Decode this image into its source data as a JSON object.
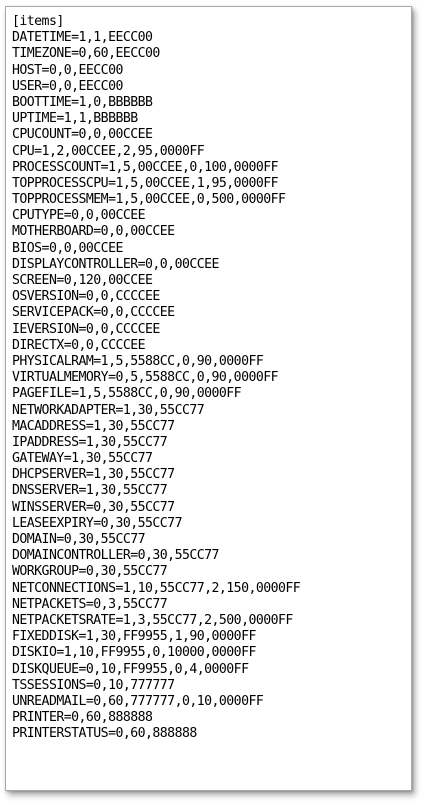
{
  "document": {
    "lines": [
      "[items]",
      "DATETIME=1,1,EECC00",
      "TIMEZONE=0,60,EECC00",
      "HOST=0,0,EECC00",
      "USER=0,0,EECC00",
      "BOOTTIME=1,0,BBBBBB",
      "UPTIME=1,1,BBBBBB",
      "CPUCOUNT=0,0,00CCEE",
      "CPU=1,2,00CCEE,2,95,0000FF",
      "PROCESSCOUNT=1,5,00CCEE,0,100,0000FF",
      "TOPPROCESSCPU=1,5,00CCEE,1,95,0000FF",
      "TOPPROCESSMEM=1,5,00CCEE,0,500,0000FF",
      "CPUTYPE=0,0,00CCEE",
      "MOTHERBOARD=0,0,00CCEE",
      "BIOS=0,0,00CCEE",
      "DISPLAYCONTROLLER=0,0,00CCEE",
      "SCREEN=0,120,00CCEE",
      "OSVERSION=0,0,CCCCEE",
      "SERVICEPACK=0,0,CCCCEE",
      "IEVERSION=0,0,CCCCEE",
      "DIRECTX=0,0,CCCCEE",
      "PHYSICALRAM=1,5,5588CC,0,90,0000FF",
      "VIRTUALMEMORY=0,5,5588CC,0,90,0000FF",
      "PAGEFILE=1,5,5588CC,0,90,0000FF",
      "NETWORKADAPTER=1,30,55CC77",
      "MACADDRESS=1,30,55CC77",
      "IPADDRESS=1,30,55CC77",
      "GATEWAY=1,30,55CC77",
      "DHCPSERVER=1,30,55CC77",
      "DNSSERVER=1,30,55CC77",
      "WINSSERVER=0,30,55CC77",
      "LEASEEXPIRY=0,30,55CC77",
      "DOMAIN=0,30,55CC77",
      "DOMAINCONTROLLER=0,30,55CC77",
      "WORKGROUP=0,30,55CC77",
      "NETCONNECTIONS=1,10,55CC77,2,150,0000FF",
      "NETPACKETS=0,3,55CC77",
      "NETPACKETSRATE=1,3,55CC77,2,500,0000FF",
      "FIXEDDISK=1,30,FF9955,1,90,0000FF",
      "DISKIO=1,10,FF9955,0,10000,0000FF",
      "DISKQUEUE=0,10,FF9955,0,4,0000FF",
      "TSSESSIONS=0,10,777777",
      "UNREADMAIL=0,60,777777,0,10,0000FF",
      "PRINTER=0,60,888888",
      "PRINTERSTATUS=0,60,888888"
    ]
  }
}
